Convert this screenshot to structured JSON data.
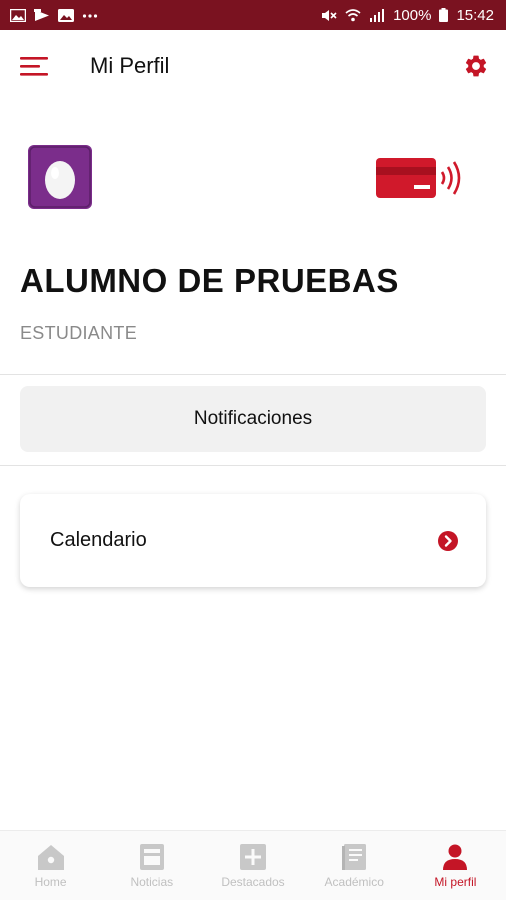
{
  "status_bar": {
    "battery": "100%",
    "time": "15:42",
    "notification_icons": [
      "gallery-icon",
      "play-store-icon",
      "image-icon",
      "more-icon"
    ],
    "system_icons": [
      "mute-icon",
      "wifi-icon",
      "signal-icon",
      "battery-icon"
    ]
  },
  "header": {
    "title": "Mi Perfil",
    "menu_icon": "menu-icon",
    "settings_icon": "gear-icon"
  },
  "profile": {
    "name": "ALUMNO DE PRUEBAS",
    "role": "ESTUDIANTE",
    "avatar_icon": "egg-avatar-icon",
    "card_icon": "nfc-card-icon"
  },
  "actions": {
    "notifications_label": "Notificaciones",
    "calendar_label": "Calendario"
  },
  "bottom_nav": {
    "items": [
      {
        "label": "Home",
        "icon": "home-icon"
      },
      {
        "label": "Noticias",
        "icon": "news-icon"
      },
      {
        "label": "Destacados",
        "icon": "plus-square-icon"
      },
      {
        "label": "Académico",
        "icon": "book-icon"
      },
      {
        "label": "Mi perfil",
        "icon": "user-icon"
      }
    ],
    "active": "Mi perfil"
  },
  "colors": {
    "status_bar": "#7a1220",
    "accent": "#c41526",
    "avatar_bg": "#7b2d8b",
    "inactive": "#c0c0c0"
  }
}
